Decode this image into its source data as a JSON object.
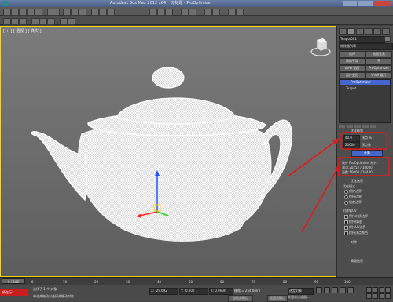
{
  "app": {
    "title": "Autodesk 3ds Max  2012 x64",
    "subtitle": "无标题 - ProOptimizer"
  },
  "viewport": {
    "label": "[ + ] [ 透视 ] [ 真实 ]"
  },
  "panel": {
    "object_name": "Teapot001",
    "modifier_list": "修改器列表",
    "buttons": [
      "选择",
      "曲面元素",
      "网格平滑",
      "壳",
      "UVW 贴图",
      "ProOptimizer",
      "面片变形",
      "UVW 展开"
    ],
    "stack": [
      "ProOptimizer",
      "Teapot"
    ],
    "rollout_optimize": "优化级别",
    "vertex_percent_value": "40.0",
    "vertex_percent_label": "顶点 %",
    "vertex_count_value": "20000",
    "vertex_count_label": "顶点数",
    "calc_button": "计算",
    "stats_line1": "统计 ProOptimizer 统计：",
    "stats_line2": "顶点:20252 / 10000",
    "stats_line3": "面数:16000 / 16400",
    "rollout_options": "优化选项",
    "optimize_mode_label": "优化模式",
    "opt_radio_1": "保护边界",
    "opt_radio_2": "保持边界",
    "opt_radio_3": "锁定边界",
    "check_label_1": "对称轴UV",
    "check_label_2": "保持材质边界",
    "check_label_3": "保持纹理",
    "check_label_4": "保持UV边界",
    "check_label_5": "保持顶点颜色",
    "rollout_symmetry": "对称",
    "rollout_history": "高级选项"
  },
  "timeline": {
    "frame_range": "0 / 100",
    "ticks": [
      "0",
      "10",
      "20",
      "30",
      "40",
      "50",
      "60",
      "70",
      "80",
      "90",
      "100"
    ]
  },
  "status": {
    "left_red": "所在行:",
    "msg1": "选择了 1 个 对象",
    "msg2": "单击并拖动以选择并移动对象",
    "x": "X: -29.692",
    "y": "Y: -0.000",
    "z": "Z: 0.0mm",
    "grid": "栅格 = 254.0mm",
    "auto_key": "自动关键点",
    "set_key": "设置关键点",
    "selected": "选定对象",
    "key_filter": "关键点过滤器..."
  },
  "colors": {
    "annotation_red": "#e01a1a",
    "selection_yellow": "#ffd400",
    "button_blue": "#4466cc"
  }
}
